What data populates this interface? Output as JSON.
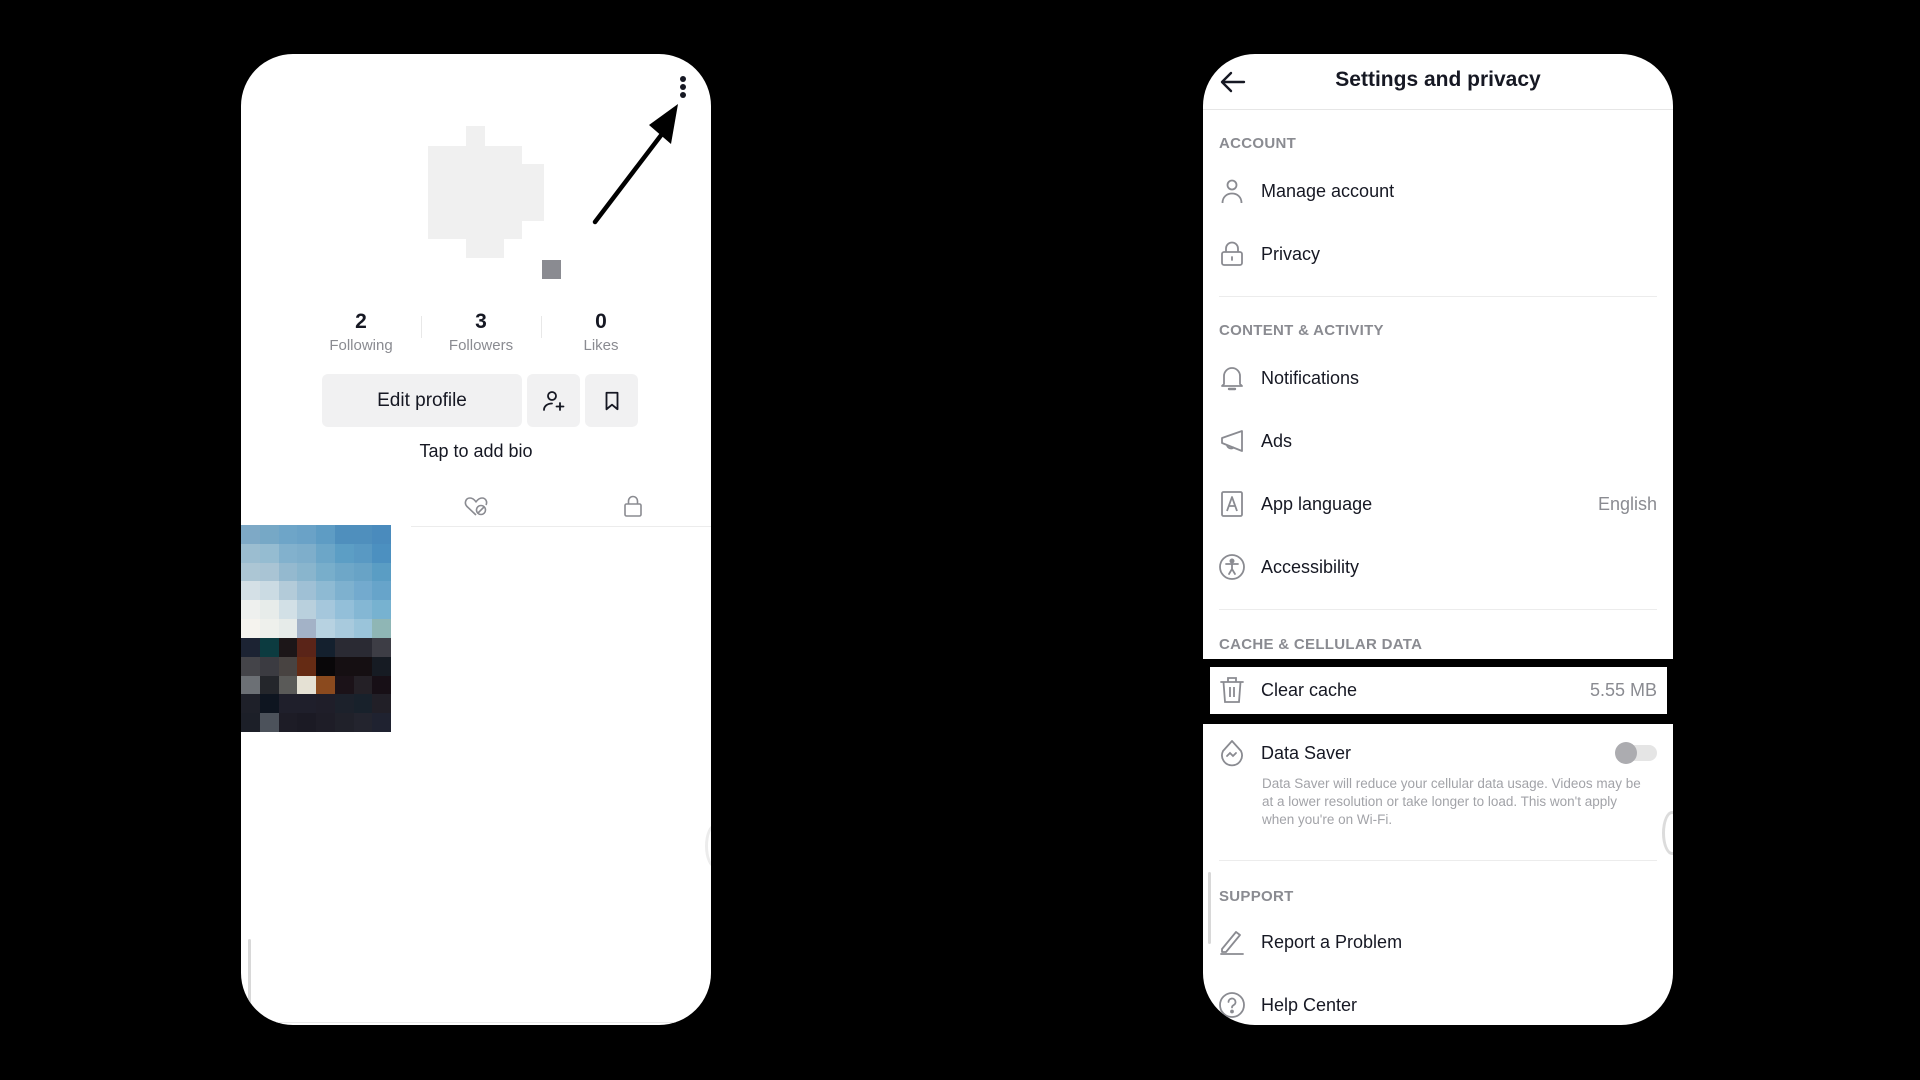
{
  "profile_screen": {
    "more_menu_icon": "vertical-ellipsis",
    "stats": [
      {
        "value": "2",
        "label": "Following"
      },
      {
        "value": "3",
        "label": "Followers"
      },
      {
        "value": "0",
        "label": "Likes"
      }
    ],
    "edit_profile_label": "Edit profile",
    "add_friend_icon": "person-plus",
    "bookmark_icon": "bookmark",
    "bio_placeholder": "Tap to add bio",
    "tabs": [
      {
        "icon": "liked-hidden-heart"
      },
      {
        "icon": "lock"
      }
    ],
    "thumbnail_colors": [
      [
        "#7ea9c6",
        "#76a8c6",
        "#6ea5c8",
        "#6aa2c7",
        "#5e9cc4",
        "#4f8fbd",
        "#4f8fbd",
        "#4a8bbd"
      ],
      [
        "#9bbdd0",
        "#95bcd1",
        "#82b1cd",
        "#7eaecb",
        "#6ca6c8",
        "#5c9ec5",
        "#5999c3",
        "#4c90c0"
      ],
      [
        "#acc6d4",
        "#a9c4d4",
        "#94b9cf",
        "#89b5cd",
        "#78aecb",
        "#6ea7c8",
        "#68a3c6",
        "#5a9dc4"
      ],
      [
        "#d4e0e6",
        "#cbdbe3",
        "#b3cbd9",
        "#9fc0d5",
        "#8ebad3",
        "#7eb1cf",
        "#73aace",
        "#67a4ca"
      ],
      [
        "#eef0ee",
        "#e7ecea",
        "#d2e0e6",
        "#b9d0dd",
        "#a5c7dc",
        "#93bfd9",
        "#84b7d4",
        "#77b2d0"
      ],
      [
        "#f5f3ee",
        "#eef0ec",
        "#e6ebe9",
        "#a3b2c7",
        "#b7d2e1",
        "#a8cadd",
        "#9ac4da",
        "#8fb6b5"
      ],
      [
        "#1c2333",
        "#0c3b40",
        "#1c1618",
        "#5a2418",
        "#14202e",
        "#2a2a33",
        "#2a2a33",
        "#3d3d45"
      ],
      [
        "#444449",
        "#3b3b41",
        "#484341",
        "#652b14",
        "#090709",
        "#150f12",
        "#150f12",
        "#161b23"
      ],
      [
        "#6c7075",
        "#24262b",
        "#5a5a58",
        "#e5e1d4",
        "#8b4a1e",
        "#1b1218",
        "#242026",
        "#170f16"
      ],
      [
        "#1e2029",
        "#0e1520",
        "#1f1f2b",
        "#1f1f2b",
        "#1f1e29",
        "#1c212b",
        "#18212b",
        "#211f27"
      ],
      [
        "#1c1f28",
        "#4c525b",
        "#1d1c26",
        "#1b1a24",
        "#1e1d27",
        "#20212a",
        "#23242e",
        "#1f2230"
      ]
    ]
  },
  "settings_screen": {
    "title": "Settings and privacy",
    "back_icon": "arrow-left",
    "sections": [
      {
        "title": "ACCOUNT",
        "items": [
          {
            "icon": "person",
            "label": "Manage account"
          },
          {
            "icon": "lock",
            "label": "Privacy"
          }
        ]
      },
      {
        "title": "CONTENT & ACTIVITY",
        "items": [
          {
            "icon": "bell",
            "label": "Notifications"
          },
          {
            "icon": "megaphone",
            "label": "Ads"
          },
          {
            "icon": "letter-a-box",
            "label": "App language",
            "value": "English"
          },
          {
            "icon": "accessibility",
            "label": "Accessibility"
          }
        ]
      },
      {
        "title": "CACHE & CELLULAR DATA",
        "items": [
          {
            "icon": "trash",
            "label": "Clear cache",
            "value": "5.55 MB",
            "highlighted": true
          },
          {
            "icon": "data-saver-drop",
            "label": "Data Saver",
            "toggle": false,
            "description": "Data Saver will reduce your cellular data usage. Videos may be at a lower resolution or take longer to load. This won't apply when you're on Wi-Fi."
          }
        ]
      },
      {
        "title": "SUPPORT",
        "items": [
          {
            "icon": "pencil",
            "label": "Report a Problem"
          },
          {
            "icon": "question-circle",
            "label": "Help Center"
          }
        ]
      }
    ]
  },
  "annotation": {
    "arrow_points_to": "more-menu-button",
    "highlight_target": "Clear cache"
  }
}
